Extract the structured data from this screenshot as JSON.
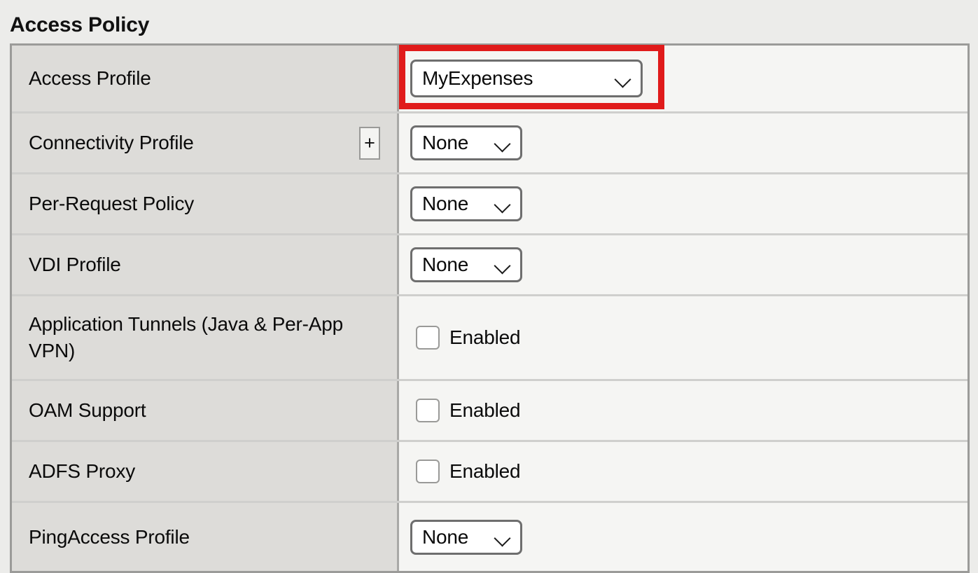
{
  "page": {
    "title": "Access Policy",
    "background_color": "#ececea",
    "accent_highlight_color": "#e01b1b"
  },
  "icons": {
    "chevron_down": "chevron-down-icon",
    "plus": "plus-icon"
  },
  "table": {
    "rows": [
      {
        "label": "Access Profile",
        "control": "select",
        "value": "MyExpenses",
        "has_add_button": false,
        "highlighted": true
      },
      {
        "label": "Connectivity Profile",
        "control": "select",
        "value": "None",
        "has_add_button": true,
        "add_button_label": "+",
        "highlighted": false
      },
      {
        "label": "Per-Request Policy",
        "control": "select",
        "value": "None",
        "has_add_button": false,
        "highlighted": false
      },
      {
        "label": "VDI Profile",
        "control": "select",
        "value": "None",
        "has_add_button": false,
        "highlighted": false
      },
      {
        "label": "Application Tunnels (Java & Per-App VPN)",
        "control": "checkbox",
        "value": "Enabled",
        "checked": false,
        "has_add_button": false,
        "highlighted": false
      },
      {
        "label": "OAM Support",
        "control": "checkbox",
        "value": "Enabled",
        "checked": false,
        "has_add_button": false,
        "highlighted": false
      },
      {
        "label": "ADFS Proxy",
        "control": "checkbox",
        "value": "Enabled",
        "checked": false,
        "has_add_button": false,
        "highlighted": false
      },
      {
        "label": "PingAccess Profile",
        "control": "select",
        "value": "None",
        "has_add_button": false,
        "highlighted": false
      }
    ]
  }
}
